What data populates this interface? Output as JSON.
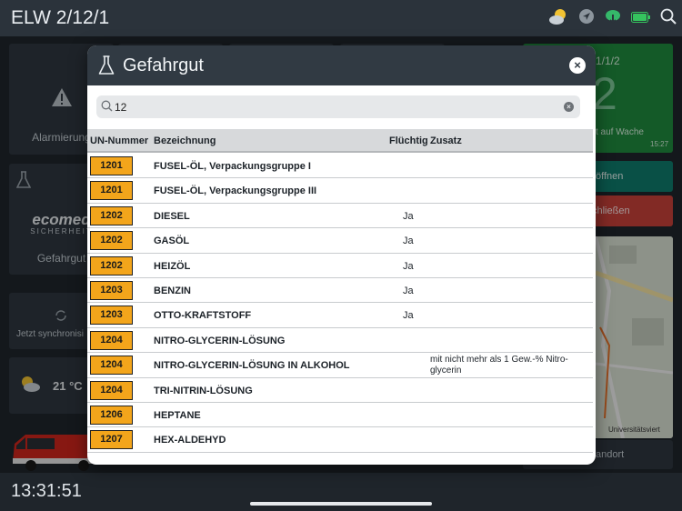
{
  "app": {
    "title": "ELW 2/12/1",
    "clock": "13:31:51"
  },
  "background": {
    "alarm_tile_label": "Alarmierung",
    "gefahrgut_tile_label": "Gefahrgut",
    "logo_text": "ecomed",
    "logo_sub": "SICHERHEIT",
    "sync_label": "Jetzt synchronisi",
    "weather_temp": "21 °C",
    "status_tile_top": "1/1/2",
    "status_tile_number": "2",
    "status_tile_text": "t auf Wache",
    "status_tile_time": "15:27",
    "open_button": "öffnen",
    "close_button": "chließen",
    "map_caption": "Universitätsviert",
    "location_label": "andort"
  },
  "modal": {
    "title": "Gefahrgut",
    "close_label": "×",
    "search": {
      "value": "12",
      "placeholder": ""
    },
    "columns": {
      "un": "UN-Nummer",
      "bez": "Bezeichnung",
      "fluechtig": "Flüchtig",
      "zusatz": "Zusatz"
    },
    "rows": [
      {
        "un": "1201",
        "bez": "FUSEL-ÖL, Verpackungsgruppe I",
        "fluechtig": "",
        "zusatz": ""
      },
      {
        "un": "1201",
        "bez": "FUSEL-ÖL, Verpackungsgruppe III",
        "fluechtig": "",
        "zusatz": ""
      },
      {
        "un": "1202",
        "bez": "DIESEL",
        "fluechtig": "Ja",
        "zusatz": ""
      },
      {
        "un": "1202",
        "bez": "GASÖL",
        "fluechtig": "Ja",
        "zusatz": ""
      },
      {
        "un": "1202",
        "bez": "HEIZÖL",
        "fluechtig": "Ja",
        "zusatz": ""
      },
      {
        "un": "1203",
        "bez": "BENZIN",
        "fluechtig": "Ja",
        "zusatz": ""
      },
      {
        "un": "1203",
        "bez": "OTTO-KRAFTSTOFF",
        "fluechtig": "Ja",
        "zusatz": ""
      },
      {
        "un": "1204",
        "bez": "NITRO-GLYCERIN-LÖSUNG",
        "fluechtig": "",
        "zusatz": ""
      },
      {
        "un": "1204",
        "bez": "NITRO-GLYCERIN-LÖSUNG IN ALKOHOL",
        "fluechtig": "",
        "zusatz": "mit nicht mehr als 1 Gew.-% Nitro-glycerin"
      },
      {
        "un": "1204",
        "bez": "TRI-NITRIN-LÖSUNG",
        "fluechtig": "",
        "zusatz": ""
      },
      {
        "un": "1206",
        "bez": "HEPTANE",
        "fluechtig": "",
        "zusatz": ""
      },
      {
        "un": "1207",
        "bez": "HEX-ALDEHYD",
        "fluechtig": "",
        "zusatz": ""
      }
    ]
  },
  "colors": {
    "un_badge": "#f3a51b",
    "header": "#313a43",
    "green": "#1f8a3e",
    "teal": "#0e7c6c",
    "red": "#c8413a"
  }
}
